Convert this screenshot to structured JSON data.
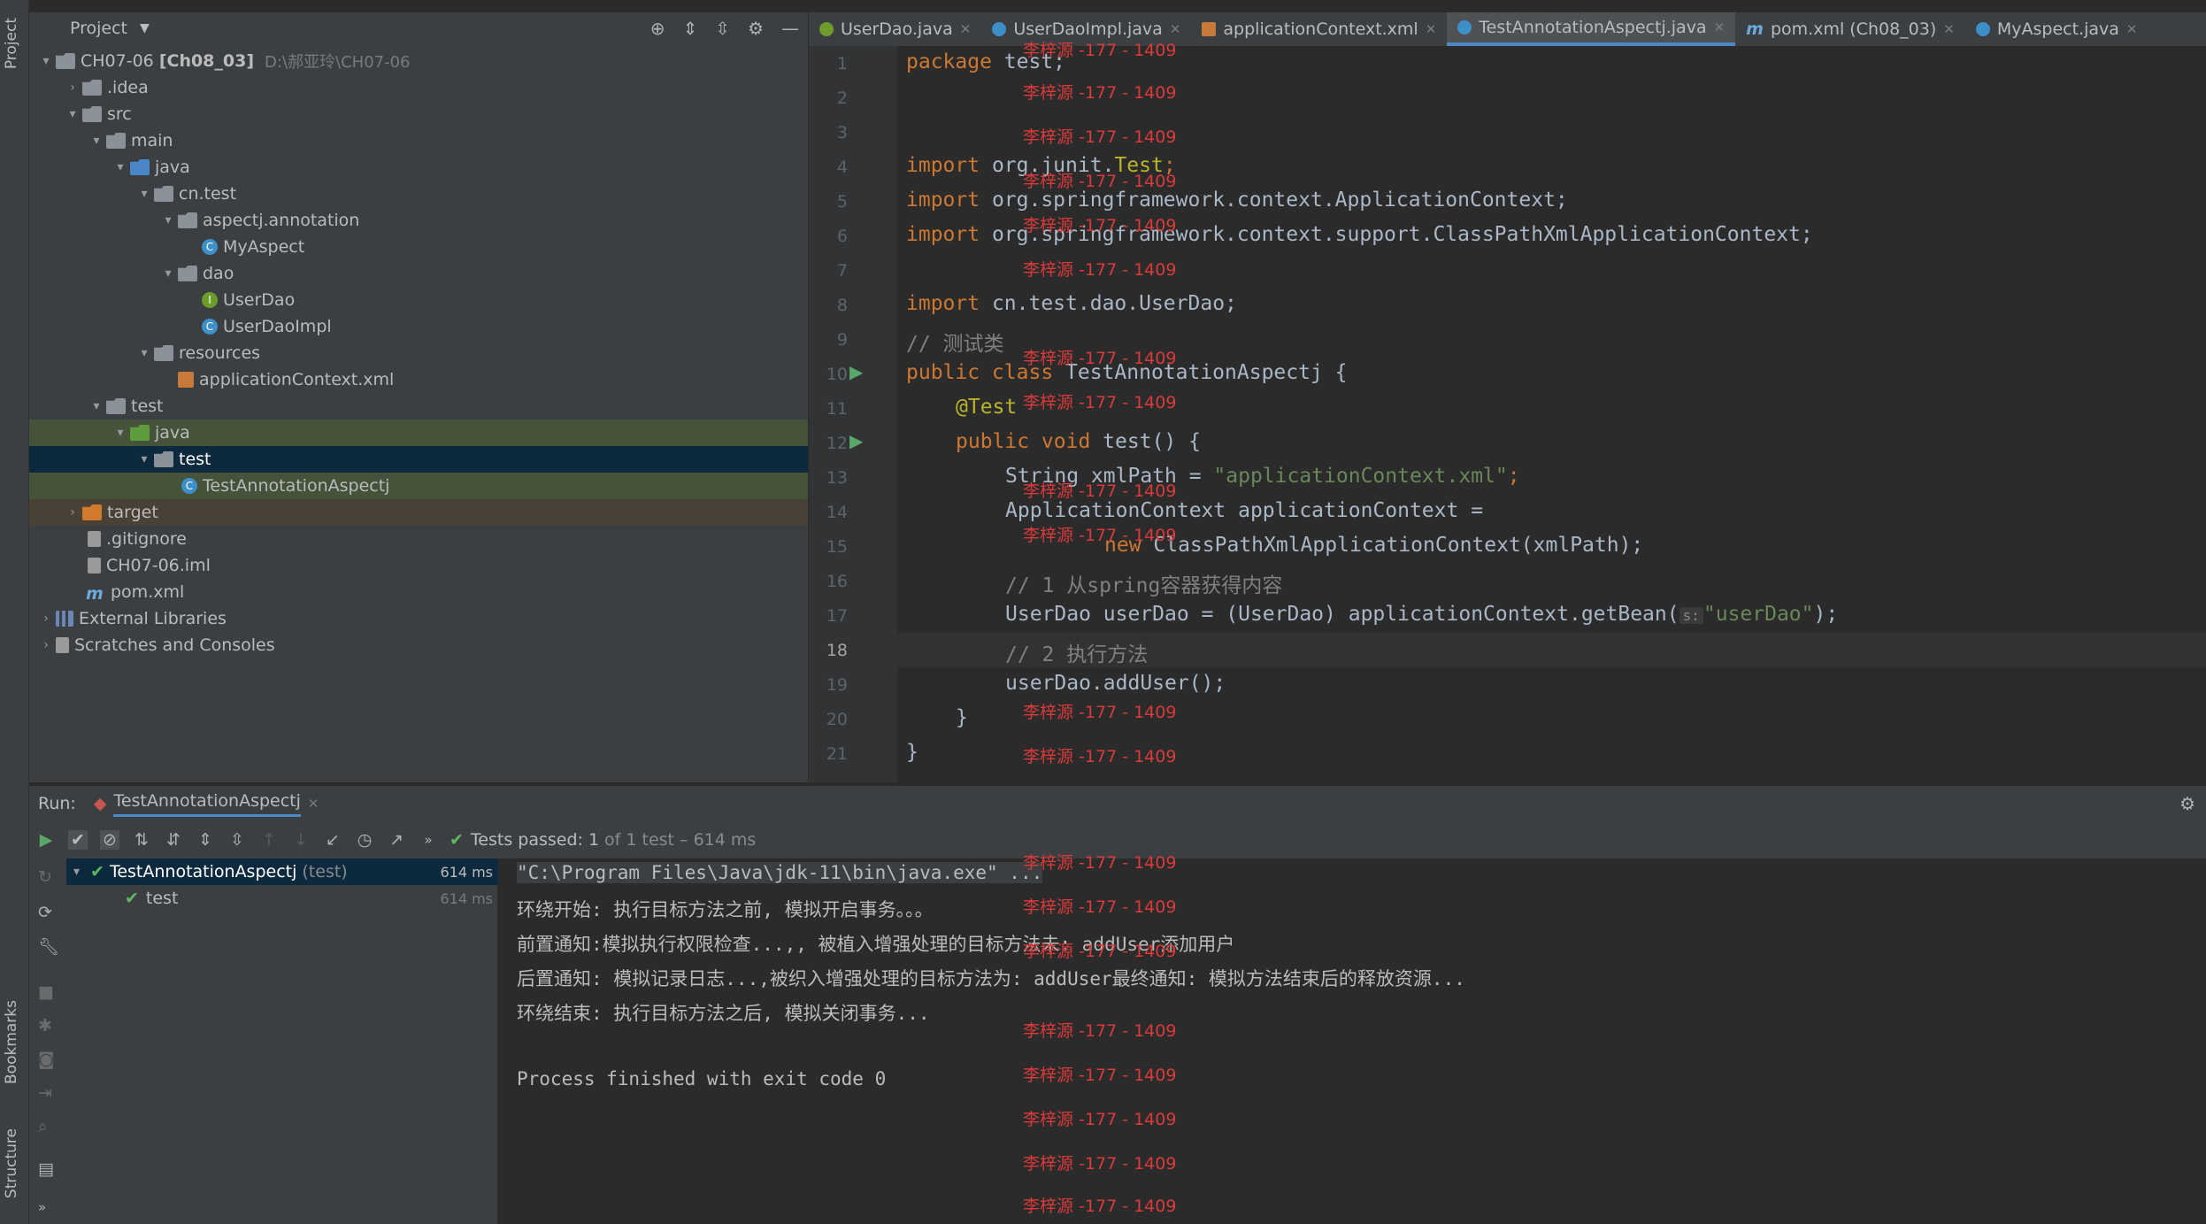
{
  "left_strip": {
    "project_tab": "Project",
    "bookmarks_tab": "Bookmarks",
    "structure_tab": "Structure"
  },
  "project": {
    "title": "Project",
    "root_name": "CH07-06",
    "root_module": "[Ch08_03]",
    "root_path": "D:\\郝亚玲\\CH07-06",
    "tree": [
      {
        "label": ".idea"
      },
      {
        "label": "src"
      },
      {
        "label": "main"
      },
      {
        "label": "java"
      },
      {
        "label": "cn.test"
      },
      {
        "label": "aspectj.annotation"
      },
      {
        "label": "MyAspect"
      },
      {
        "label": "dao"
      },
      {
        "label": "UserDao"
      },
      {
        "label": "UserDaoImpl"
      },
      {
        "label": "resources"
      },
      {
        "label": "applicationContext.xml"
      },
      {
        "label": "test"
      },
      {
        "label": "java"
      },
      {
        "label": "test"
      },
      {
        "label": "TestAnnotationAspectj"
      },
      {
        "label": "target"
      },
      {
        "label": ".gitignore"
      },
      {
        "label": "CH07-06.iml"
      },
      {
        "label": "pom.xml"
      },
      {
        "label": "External Libraries"
      },
      {
        "label": "Scratches and Consoles"
      }
    ]
  },
  "editor_tabs": [
    {
      "label": "UserDao.java"
    },
    {
      "label": "UserDaoImpl.java"
    },
    {
      "label": "applicationContext.xml"
    },
    {
      "label": "TestAnnotationAspectj.java"
    },
    {
      "label": "pom.xml (Ch08_03)"
    },
    {
      "label": "MyAspect.java"
    }
  ],
  "code": {
    "line_numbers": [
      "1",
      "2",
      "3",
      "4",
      "5",
      "6",
      "7",
      "8",
      "9",
      "10",
      "11",
      "12",
      "13",
      "14",
      "15",
      "16",
      "17",
      "18",
      "19",
      "20",
      "21"
    ],
    "l1_kw": "package",
    "l1_rest": " test;",
    "import_kw": "import",
    "l4_rest": " org.junit.",
    "l4_ann": "Test",
    "l4_end": ";",
    "l5_rest": " org.springframework.context.ApplicationContext;",
    "l6_rest": " org.springframework.context.support.ClassPathXmlApplicationContext;",
    "l8_rest": " cn.test.dao.UserDao;",
    "l9_comment": "// 测试类",
    "l10_kw": "public class",
    "l10_rest": " TestAnnotationAspectj {",
    "l11_ann": "@Test",
    "l12_kw": "public void",
    "l12_rest": " test() {",
    "l13_a": "String xmlPath = ",
    "l13_str": "\"applicationContext.xml\"",
    "l13_end": ";",
    "l14": "ApplicationContext applicationContext =",
    "l15_kw": "new",
    "l15_rest": " ClassPathXmlApplicationContext(xmlPath);",
    "l16_comment": "// 1 从spring容器获得内容",
    "l17_a": "UserDao userDao = (UserDao) applicationContext.getBean(",
    "l17_hint": "s:",
    "l17_str": "\"userDao\"",
    "l17_end": ");",
    "l18_comment": "// 2 执行方法",
    "l19": "userDao.addUser();",
    "l20": "}",
    "l21": "}"
  },
  "watermark": "李梓源 -177 - 1409",
  "run": {
    "label": "Run:",
    "config_name": "TestAnnotationAspectj",
    "tests_passed_label": "Tests passed:",
    "tests_passed_count": "1",
    "tests_passed_rest": "of 1 test – 614 ms",
    "tree_root": "TestAnnotationAspectj",
    "tree_root_suffix": "(test)",
    "tree_root_time": "614 ms",
    "tree_child": "test",
    "tree_child_time": "614 ms"
  },
  "console": [
    "\"C:\\Program Files\\Java\\jdk-11\\bin\\java.exe\" ...",
    "环绕开始: 执行目标方法之前, 模拟开启事务。。。",
    "前置通知:模拟执行权限检查...,, 被植入增强处理的目标方法未: addUser添加用户",
    "后置通知: 模拟记录日志...,被织入增强处理的目标方法为: addUser最终通知: 模拟方法结束后的释放资源...",
    "环绕结束: 执行目标方法之后, 模拟关闭事务...",
    "",
    "Process finished with exit code 0"
  ]
}
